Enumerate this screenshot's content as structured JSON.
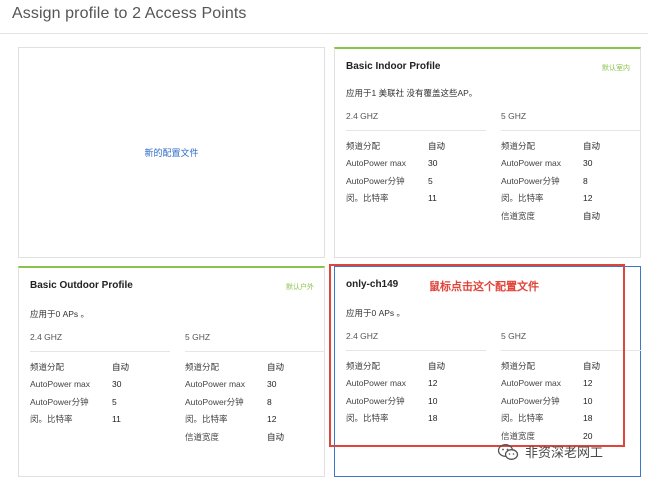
{
  "page": {
    "title": "Assign profile to 2 Access Points"
  },
  "new_profile": {
    "label": "新的配置文件"
  },
  "cards": {
    "indoor": {
      "name": "Basic Indoor Profile",
      "tag": "默认室内",
      "applied": "应用于1 美联社 没有覆盖这些AP。",
      "band24": {
        "title": "2.4 GHZ",
        "rows": [
          {
            "k": "频道分配",
            "v": "自动"
          },
          {
            "k": "AutoPower max",
            "v": "30"
          },
          {
            "k": "AutoPower分钟",
            "v": "5"
          },
          {
            "k": "闵。比特率",
            "v": "11"
          }
        ]
      },
      "band5": {
        "title": "5 GHZ",
        "rows": [
          {
            "k": "频道分配",
            "v": "自动"
          },
          {
            "k": "AutoPower max",
            "v": "30"
          },
          {
            "k": "AutoPower分钟",
            "v": "8"
          },
          {
            "k": "闵。比特率",
            "v": "12"
          },
          {
            "k": "信道宽度",
            "v": "自动"
          }
        ]
      }
    },
    "outdoor": {
      "name": "Basic Outdoor Profile",
      "tag": "默认户外",
      "applied": "应用于0 APs 。",
      "band24": {
        "title": "2.4 GHZ",
        "rows": [
          {
            "k": "频道分配",
            "v": "自动"
          },
          {
            "k": "AutoPower max",
            "v": "30"
          },
          {
            "k": "AutoPower分钟",
            "v": "5"
          },
          {
            "k": "闵。比特率",
            "v": "11"
          }
        ]
      },
      "band5": {
        "title": "5 GHZ",
        "rows": [
          {
            "k": "频道分配",
            "v": "自动"
          },
          {
            "k": "AutoPower max",
            "v": "30"
          },
          {
            "k": "AutoPower分钟",
            "v": "8"
          },
          {
            "k": "闵。比特率",
            "v": "12"
          },
          {
            "k": "信道宽度",
            "v": "自动"
          }
        ]
      }
    },
    "custom": {
      "name": "only-ch149",
      "applied": "应用于0 APs 。",
      "band24": {
        "title": "2.4 GHZ",
        "rows": [
          {
            "k": "频道分配",
            "v": "自动"
          },
          {
            "k": "AutoPower max",
            "v": "12"
          },
          {
            "k": "AutoPower分钟",
            "v": "10"
          },
          {
            "k": "闵。比特率",
            "v": "18"
          }
        ]
      },
      "band5": {
        "title": "5 GHZ",
        "rows": [
          {
            "k": "频道分配",
            "v": "自动"
          },
          {
            "k": "AutoPower max",
            "v": "12"
          },
          {
            "k": "AutoPower分钟",
            "v": "10"
          },
          {
            "k": "闵。比特率",
            "v": "18"
          },
          {
            "k": "信道宽度",
            "v": "20"
          }
        ]
      }
    }
  },
  "annotation": "鼠标点击这个配置文件",
  "watermark": "非资深老网工",
  "colors": {
    "accent_green": "#8bc34a",
    "link_blue": "#2b6bc4",
    "annotation_red": "#e0453a",
    "selected_blue": "#3b78c9"
  }
}
